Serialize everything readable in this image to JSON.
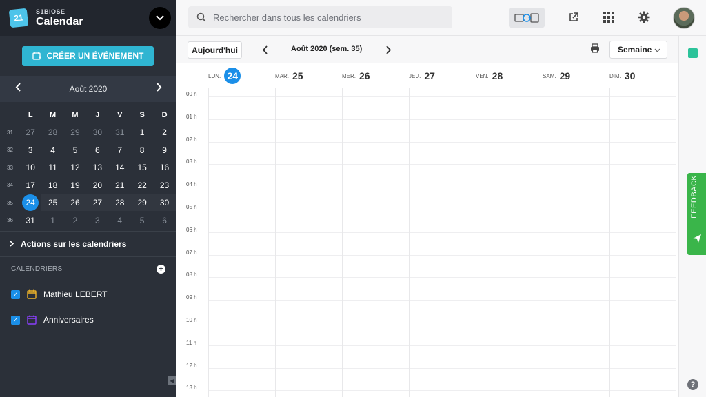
{
  "brand": {
    "org": "S1BIOSE",
    "app": "Calendar",
    "logo_text": "21"
  },
  "create_button": {
    "label": "CRÉER UN ÉVÉNEMENT"
  },
  "mini_calendar": {
    "title": "Août 2020",
    "day_headers": [
      "L",
      "M",
      "M",
      "J",
      "V",
      "S",
      "D"
    ],
    "weeks": [
      {
        "week": "31",
        "days": [
          "27",
          "28",
          "29",
          "30",
          "31",
          "1",
          "2"
        ],
        "out": [
          true,
          true,
          true,
          true,
          true,
          false,
          false
        ]
      },
      {
        "week": "32",
        "days": [
          "3",
          "4",
          "5",
          "6",
          "7",
          "8",
          "9"
        ],
        "out": [
          false,
          false,
          false,
          false,
          false,
          false,
          false
        ]
      },
      {
        "week": "33",
        "days": [
          "10",
          "11",
          "12",
          "13",
          "14",
          "15",
          "16"
        ],
        "out": [
          false,
          false,
          false,
          false,
          false,
          false,
          false
        ]
      },
      {
        "week": "34",
        "days": [
          "17",
          "18",
          "19",
          "20",
          "21",
          "22",
          "23"
        ],
        "out": [
          false,
          false,
          false,
          false,
          false,
          false,
          false
        ]
      },
      {
        "week": "35",
        "days": [
          "24",
          "25",
          "26",
          "27",
          "28",
          "29",
          "30"
        ],
        "out": [
          false,
          false,
          false,
          false,
          false,
          false,
          false
        ]
      },
      {
        "week": "36",
        "days": [
          "31",
          "1",
          "2",
          "3",
          "4",
          "5",
          "6"
        ],
        "out": [
          false,
          true,
          true,
          true,
          true,
          true,
          true
        ]
      }
    ],
    "today": "24"
  },
  "actions": {
    "label": "Actions sur les calendriers"
  },
  "calendars": {
    "heading": "CALENDRIERS",
    "items": [
      {
        "label": "Mathieu LEBERT",
        "color": "#f0b429"
      },
      {
        "label": "Anniversaires",
        "color": "#8a3ffc"
      }
    ]
  },
  "search": {
    "placeholder": "Rechercher dans tous les calendriers"
  },
  "toolbar": {
    "today_label": "Aujourd'hui",
    "period": "Août 2020 (sem. 35)",
    "view": "Semaine"
  },
  "week_days": [
    {
      "name": "LUN.",
      "num": "24",
      "today": true
    },
    {
      "name": "MAR.",
      "num": "25"
    },
    {
      "name": "MER.",
      "num": "26"
    },
    {
      "name": "JEU.",
      "num": "27"
    },
    {
      "name": "VEN.",
      "num": "28"
    },
    {
      "name": "SAM.",
      "num": "29"
    },
    {
      "name": "DIM.",
      "num": "30"
    }
  ],
  "hours": [
    "00 h",
    "01 h",
    "02 h",
    "03 h",
    "04 h",
    "05 h",
    "06 h",
    "07 h",
    "08 h",
    "09 h",
    "10 h",
    "11 h",
    "12 h",
    "13 h"
  ],
  "feedback": {
    "label": "FEEDBACK"
  },
  "help": {
    "label": "?"
  },
  "colors": {
    "accent": "#2fb5d2",
    "today": "#1b8fe8",
    "feedback": "#3ab54a",
    "sidebar": "#2b3039"
  }
}
